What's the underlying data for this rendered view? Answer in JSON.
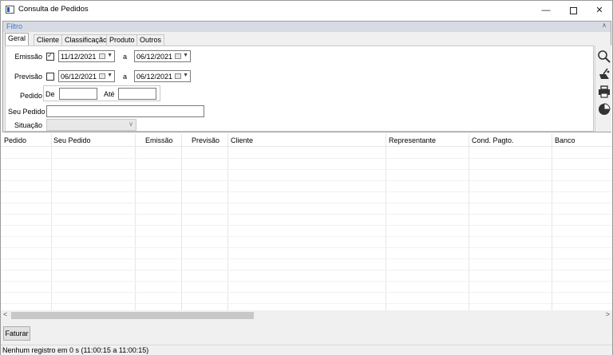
{
  "window": {
    "title": "Consulta de Pedidos"
  },
  "filter": {
    "title": "Filtro",
    "tabs": [
      "Geral",
      "Cliente",
      "Classificação",
      "Produto",
      "Outros"
    ],
    "emissao": {
      "label": "Emissão",
      "checked": true,
      "from": "11/12/2021",
      "sep": "a",
      "to": "06/12/2021"
    },
    "previsao": {
      "label": "Previsão",
      "checked": false,
      "from": "06/12/2021",
      "sep": "a",
      "to": "06/12/2021"
    },
    "pedido": {
      "label": "Pedido",
      "from_label": "De",
      "to_label": "Até",
      "from": "",
      "to": ""
    },
    "seu_pedido": {
      "label": "Seu Pedido",
      "value": ""
    },
    "situacao": {
      "label": "Situação",
      "value": ""
    }
  },
  "toolbar": {
    "icons": [
      "search-icon",
      "clear-icon",
      "print-icon",
      "chart-icon"
    ]
  },
  "grid": {
    "columns": [
      "Pedido",
      "Seu Pedido",
      "Emissão",
      "Previsão",
      "Cliente",
      "Representante",
      "Cond. Pagto.",
      "Banco"
    ],
    "rows": []
  },
  "actions": {
    "faturar": "Faturar"
  },
  "status": {
    "text": "Nenhum registro em 0 s (11:00:15 a 11:00:15)"
  }
}
